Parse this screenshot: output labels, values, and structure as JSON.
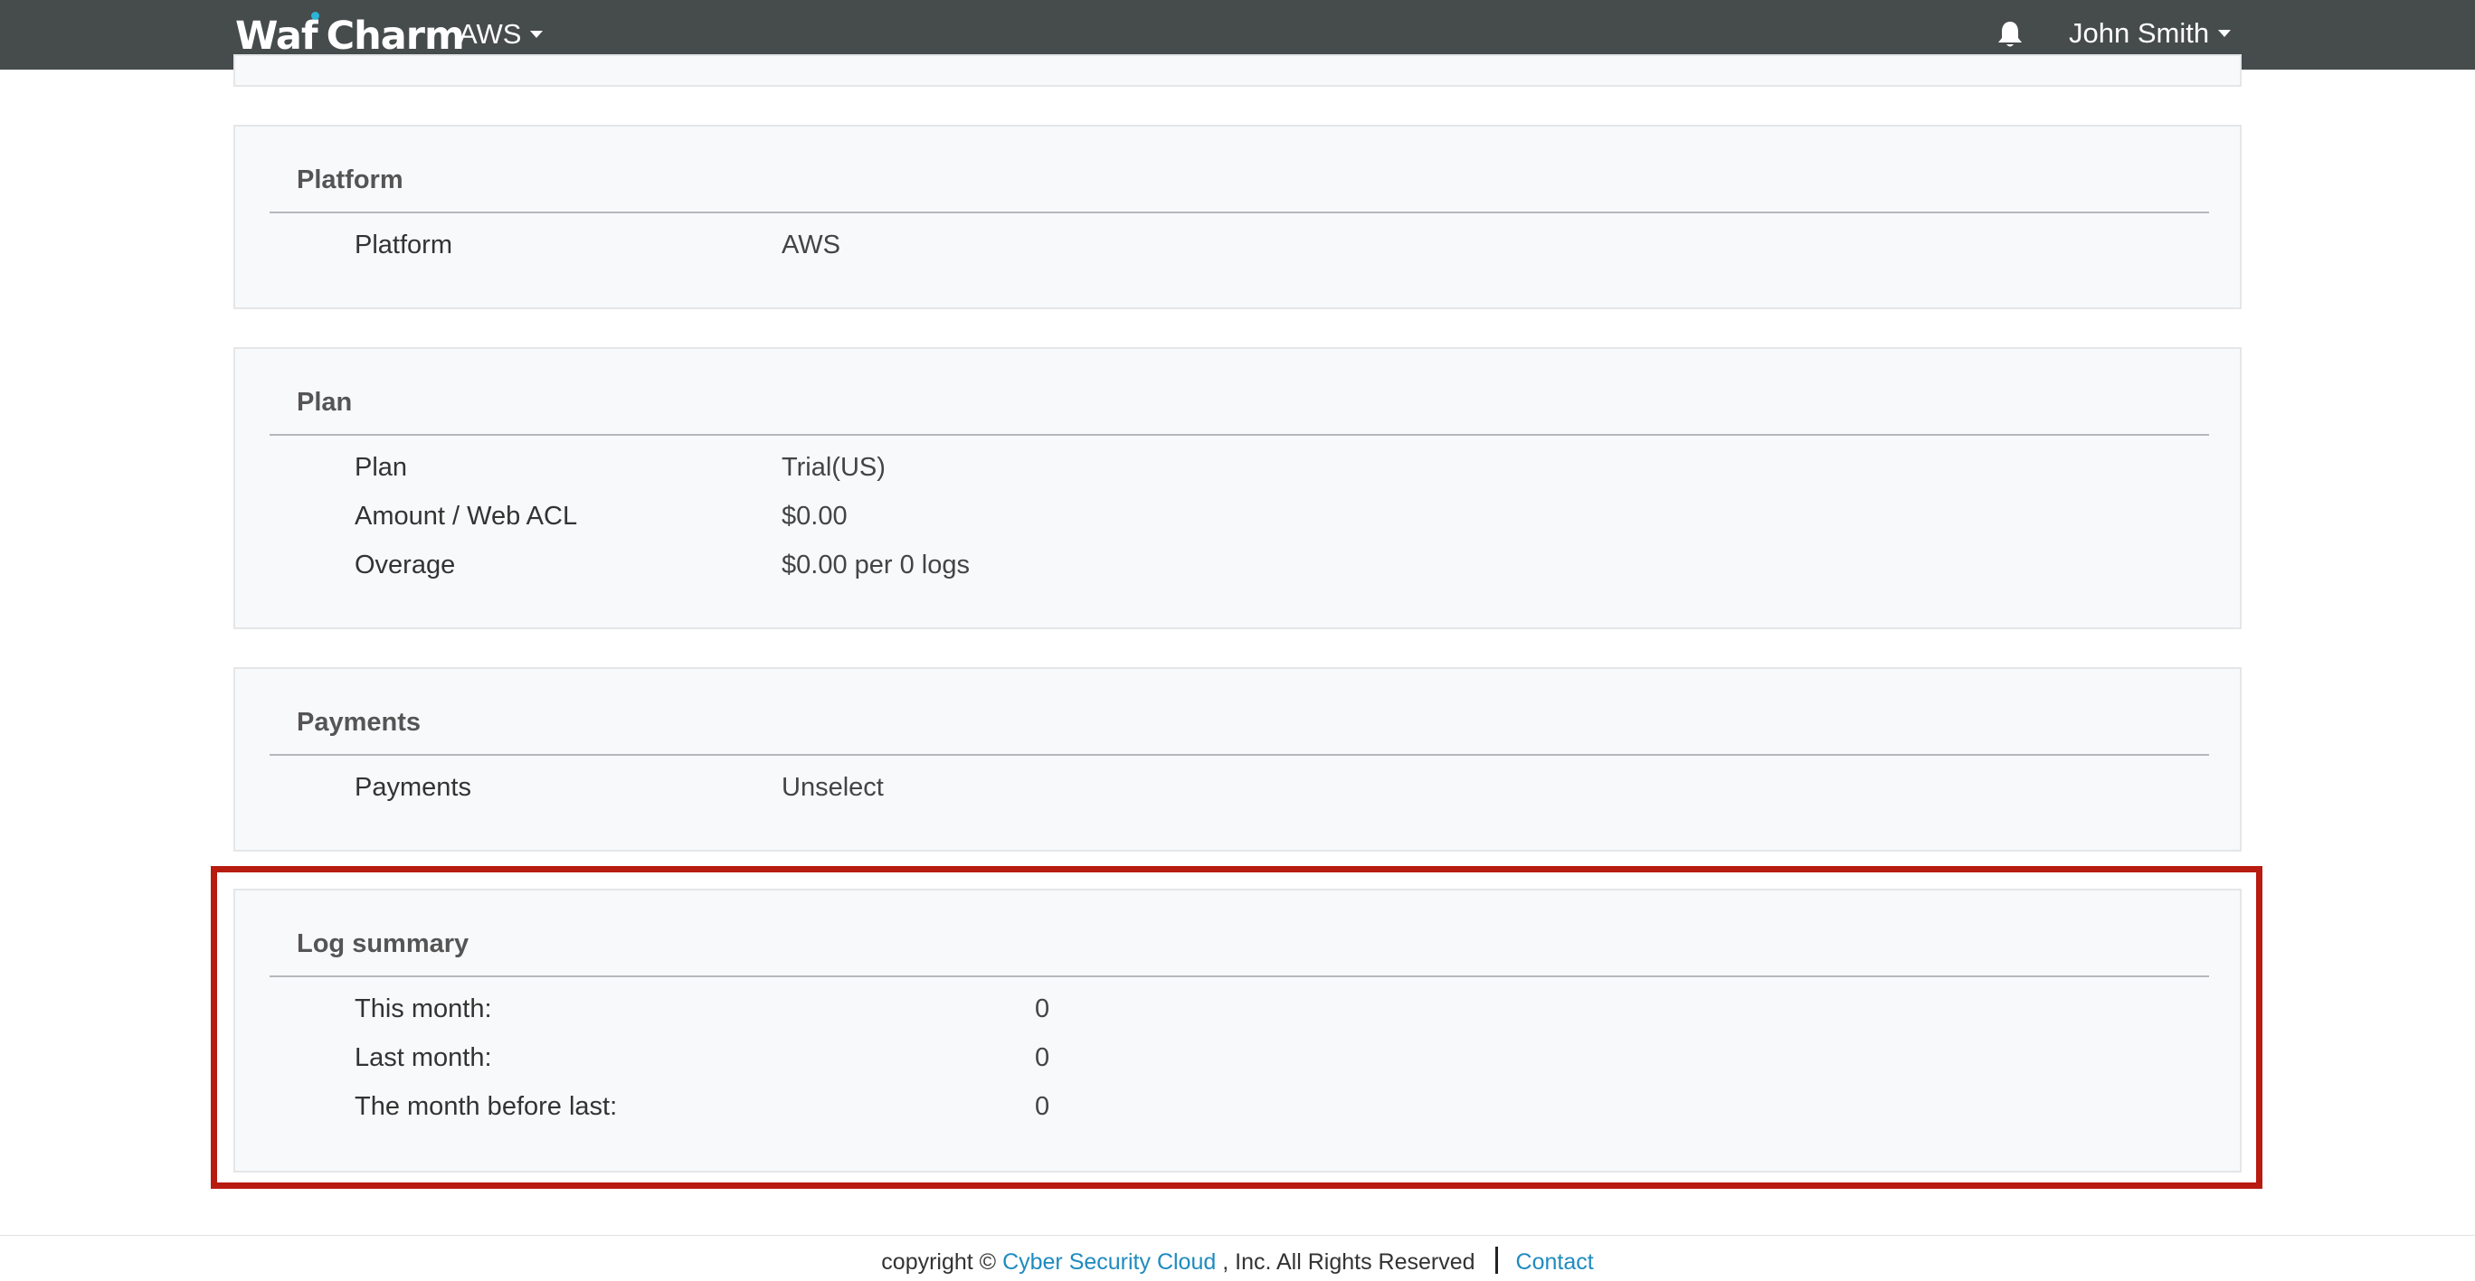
{
  "navbar": {
    "brand_part1": "Waf",
    "brand_part2": "Charm",
    "platform_menu_label": "AWS",
    "user_menu_label": "John Smith",
    "bell_icon": "bell-icon",
    "background_color": "#464b4c",
    "accent_color": "#2bb3d8"
  },
  "sections": {
    "platform": {
      "heading": "Platform",
      "rows": [
        {
          "label": "Platform",
          "value": "AWS"
        }
      ]
    },
    "plan": {
      "heading": "Plan",
      "rows": [
        {
          "label": "Plan",
          "value": "Trial(US)"
        },
        {
          "label": "Amount / Web ACL",
          "value": "$0.00"
        },
        {
          "label": "Overage",
          "value": "$0.00 per 0 logs"
        }
      ]
    },
    "payments": {
      "heading": "Payments",
      "rows": [
        {
          "label": "Payments",
          "value": "Unselect"
        }
      ]
    },
    "log_summary": {
      "heading": "Log summary",
      "rows": [
        {
          "label": "This month:",
          "value": "0"
        },
        {
          "label": "Last month:",
          "value": "0"
        },
        {
          "label": "The month before last:",
          "value": "0"
        }
      ],
      "highlight_color": "#b81b10"
    }
  },
  "footer": {
    "copyright_prefix": "copyright © ",
    "company_link": "Cyber Security Cloud",
    "copyright_suffix": " , Inc. All Rights Reserved",
    "contact_link": "Contact",
    "link_color": "#1f8bbf"
  }
}
